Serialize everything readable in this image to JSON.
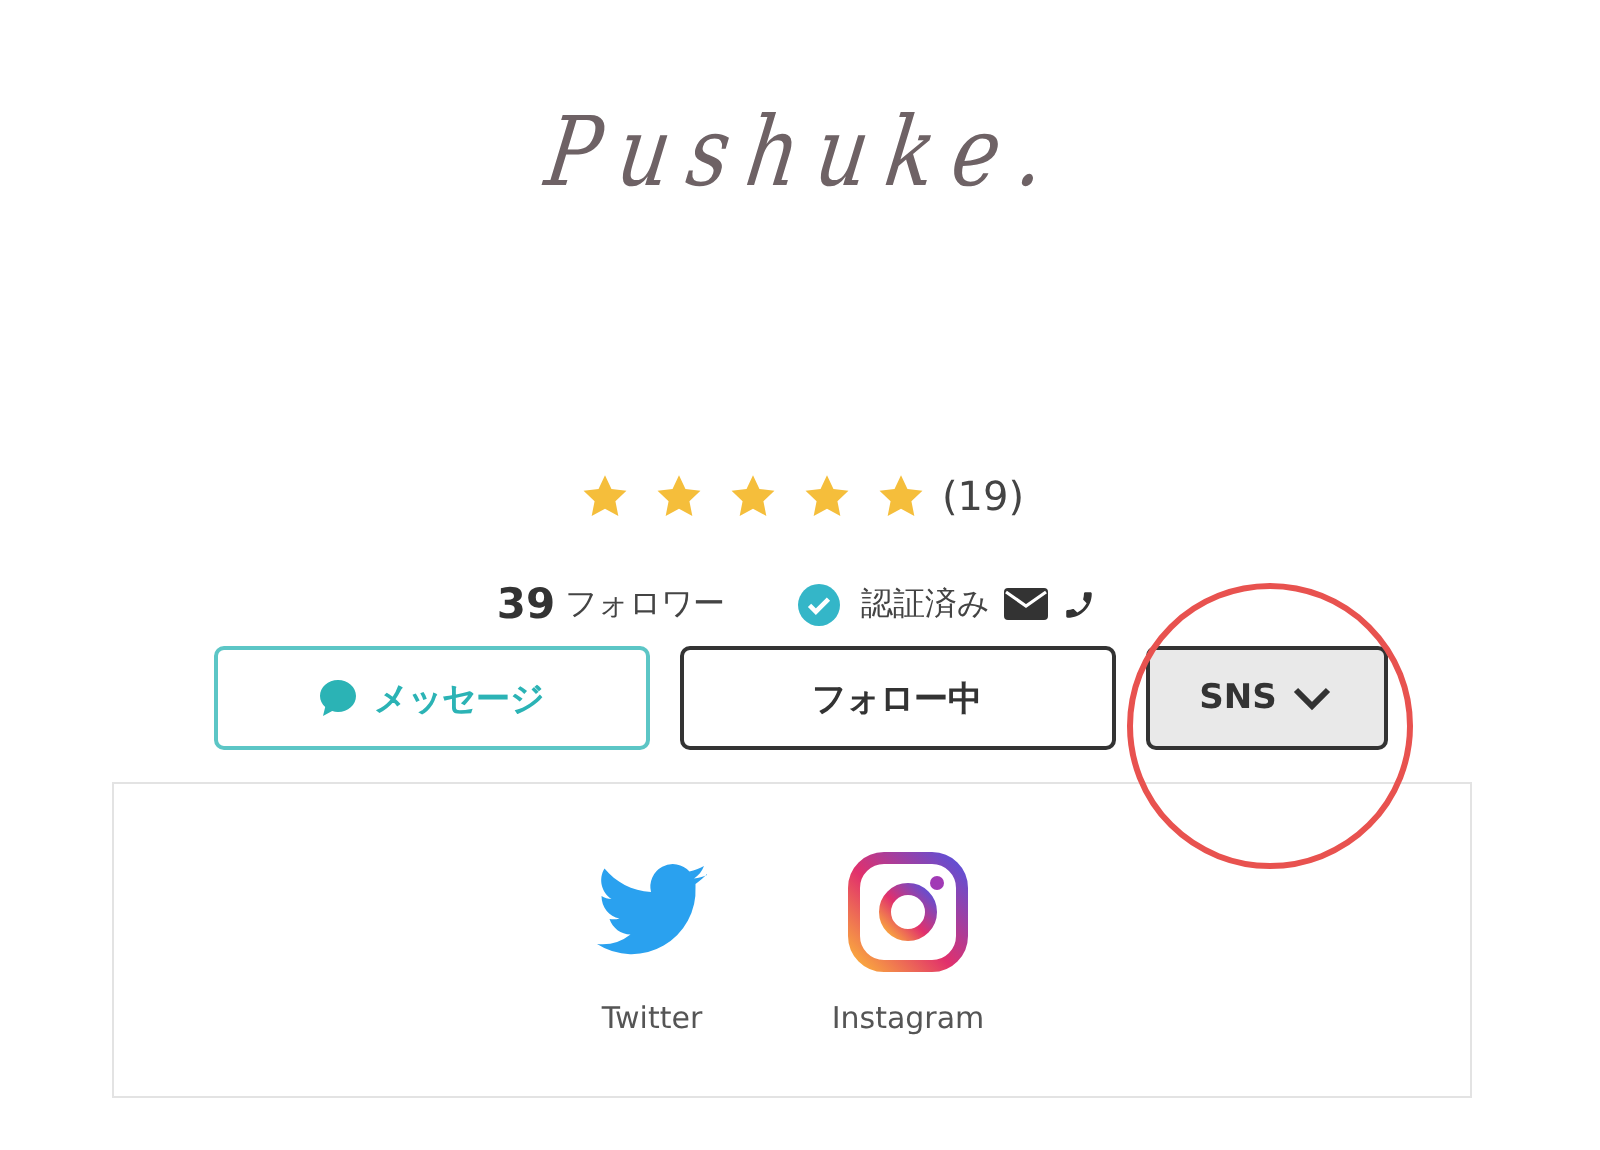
{
  "logo": {
    "text": "Pushuke."
  },
  "rating": {
    "stars": 5,
    "count": "(19)"
  },
  "stats": {
    "followers": "39",
    "followers_label": "フォロワー",
    "verified": true,
    "verified_label": "認証済み"
  },
  "buttons": [
    {
      "kind": "message",
      "label": "メッセージ"
    },
    {
      "kind": "follow",
      "label": "フォロー中"
    },
    {
      "kind": "dropdown",
      "label": "SNS",
      "expanded": true
    }
  ],
  "sns_links": [
    {
      "kind": "twitter",
      "label": "Twitter"
    },
    {
      "kind": "instagram",
      "label": "Instagram"
    }
  ],
  "annotation": {
    "kind": "circle"
  }
}
